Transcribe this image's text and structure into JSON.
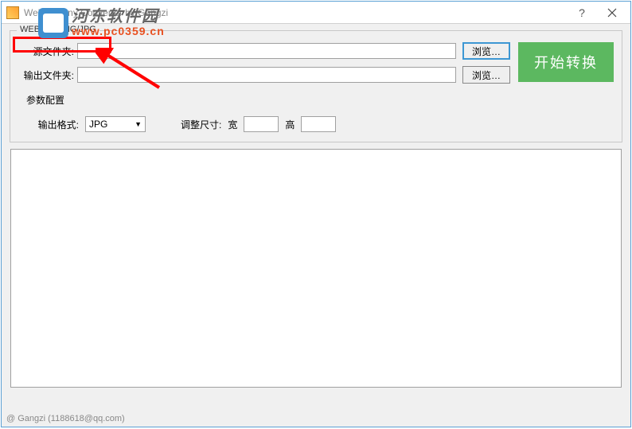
{
  "window": {
    "title": "Webp to Any Converter by Gangzi"
  },
  "groupbox": {
    "legend": "WEBP to PNG/JPG"
  },
  "labels": {
    "source": "源文件夹:",
    "output": "输出文件夹:",
    "browse": "浏览…",
    "start": "开始转换",
    "params": "参数配置",
    "outfmt": "输出格式:",
    "outfmt_value": "JPG",
    "resize": "调整尺寸:",
    "width": "宽",
    "height": "高"
  },
  "fields": {
    "source_value": "",
    "output_value": "",
    "width_value": "",
    "height_value": ""
  },
  "footer": {
    "credit": "@ Gangzi (1188618@qq.com)"
  },
  "watermark": {
    "cn": "河东软件园",
    "url": "www.pc0359.cn"
  }
}
